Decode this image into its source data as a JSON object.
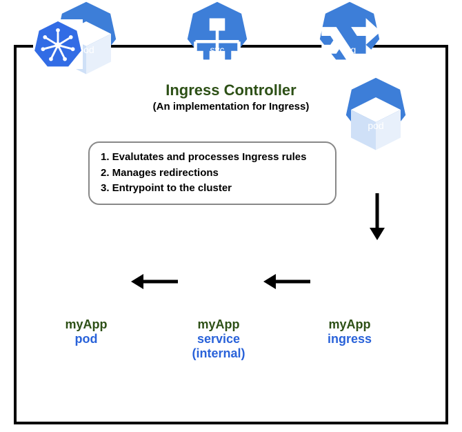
{
  "title": {
    "main": "Ingress Controller",
    "sub": "(An implementation for Ingress)"
  },
  "rules": {
    "r1": "1. Evalutates and processes Ingress rules",
    "r2": "2. Manages redirections",
    "r3": "3. Entrypoint to the cluster"
  },
  "nodes": {
    "pod_top": {
      "label": "pod"
    },
    "pod_bottom": {
      "label": "pod"
    },
    "svc": {
      "label": "svc"
    },
    "ing": {
      "label": "ing"
    }
  },
  "captions": {
    "pod": {
      "name": "myApp",
      "type": "pod"
    },
    "svc": {
      "name": "myApp",
      "type": "service",
      "extra": "(internal)"
    },
    "ing": {
      "name": "myApp",
      "type": "ingress"
    }
  },
  "colors": {
    "hept_fill": "#3d7ed8",
    "green": "#2d5016",
    "blue": "#2962d9"
  }
}
